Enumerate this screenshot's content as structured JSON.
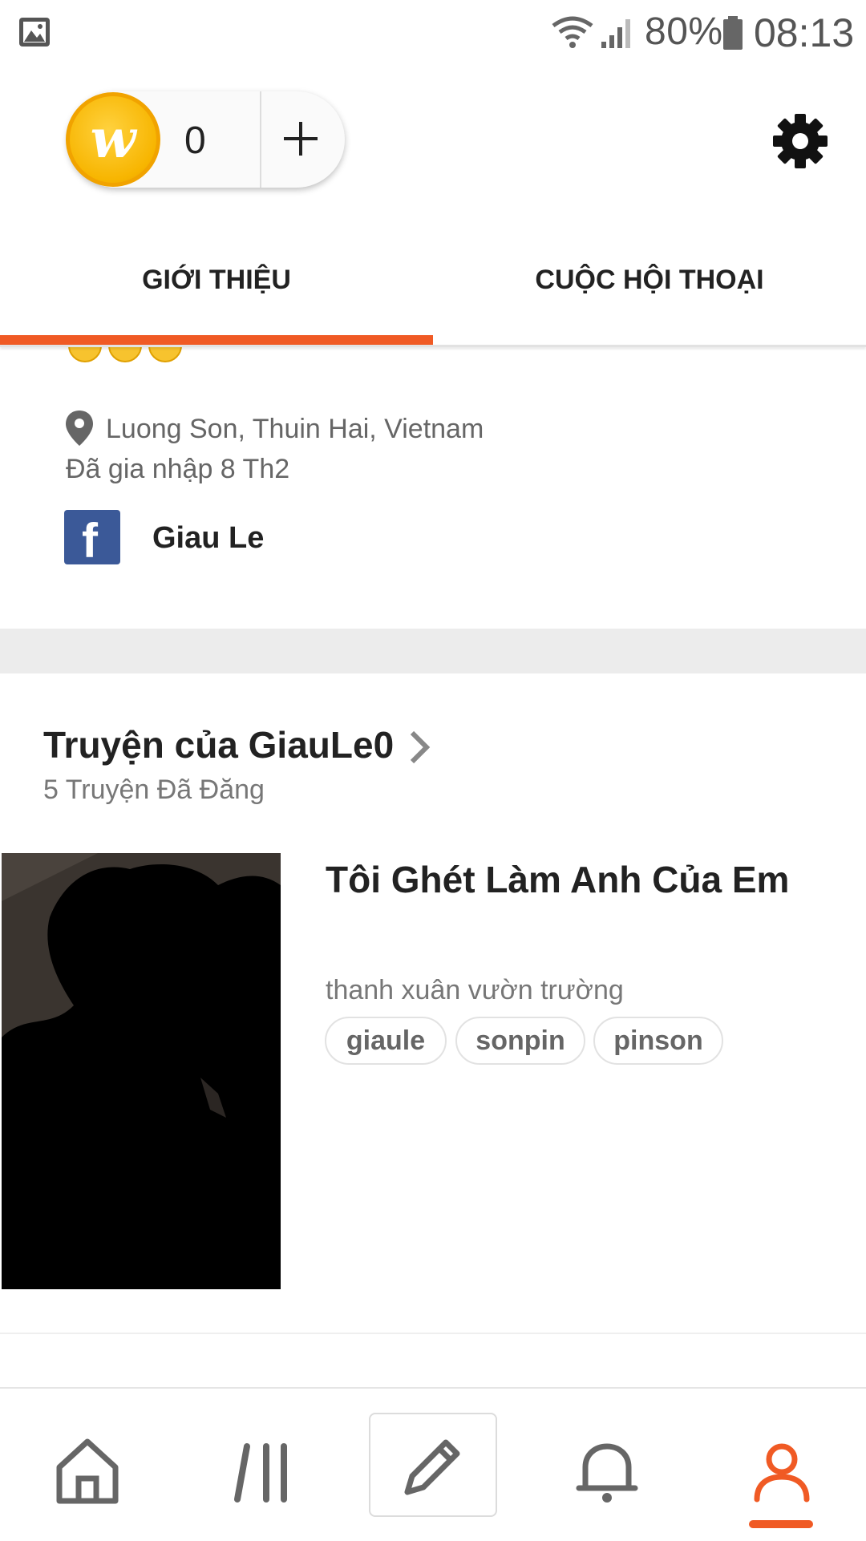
{
  "status_bar": {
    "battery": "80%",
    "time": "08:13",
    "icons": [
      "gallery-icon",
      "wifi-icon",
      "signal-icon",
      "battery-icon"
    ]
  },
  "wallet": {
    "coin_symbol": "w",
    "coin_count": "0"
  },
  "tabs": [
    {
      "label": "GIỚI THIỆU",
      "active": true
    },
    {
      "label": "CUỘC HỘI THOẠI",
      "active": false
    }
  ],
  "about": {
    "location": "Luong Son, Thuin Hai, Vietnam",
    "joined": "Đã gia nhập 8 Th2",
    "facebook_name": "Giau Le"
  },
  "stories": {
    "title": "Truyện của GiauLe0",
    "count_label": "5 Truyện Đã Đăng",
    "items": [
      {
        "title": "Tôi Ghét Làm Anh Của Em",
        "genre": "thanh xuân vườn trường",
        "tags": [
          "giaule",
          "sonpin",
          "pinson"
        ]
      }
    ]
  },
  "bottom_nav": {
    "items": [
      "home-icon",
      "library-icon",
      "write-icon",
      "notifications-icon",
      "profile-icon"
    ],
    "active": "profile-icon"
  },
  "colors": {
    "accent": "#f05a24",
    "facebook": "#3b5998",
    "coin": "#f7b500"
  }
}
